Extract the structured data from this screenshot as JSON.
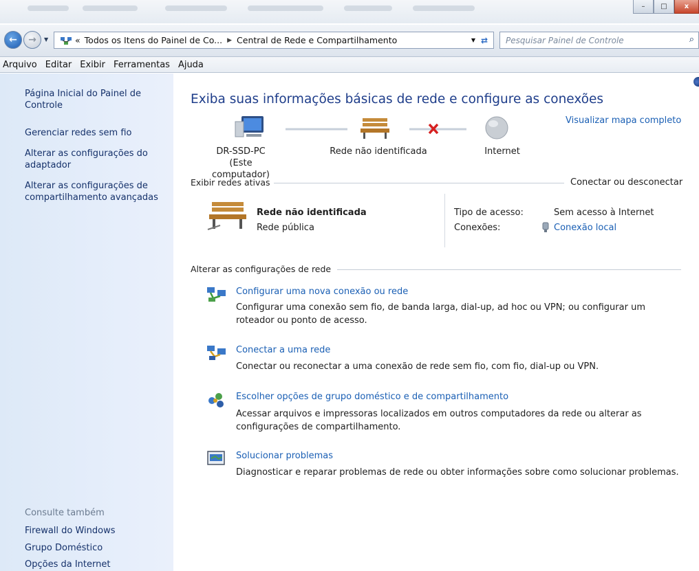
{
  "window": {
    "minimize": "–",
    "maximize": "□",
    "close": "x"
  },
  "address": {
    "crumb_prefix": "«",
    "crumb1": "Todos os Itens do Painel de Co...",
    "crumb2": "Central de Rede e Compartilhamento",
    "search_placeholder": "Pesquisar Painel de Controle"
  },
  "menu": [
    "Arquivo",
    "Editar",
    "Exibir",
    "Ferramentas",
    "Ajuda"
  ],
  "sidebar": {
    "links": [
      "Página Inicial do Painel de Controle",
      "Gerenciar redes sem fio",
      "Alterar as configurações do adaptador",
      "Alterar as configurações de compartilhamento avançadas"
    ],
    "see_also_label": "Consulte também",
    "see_also": [
      "Firewall do Windows",
      "Grupo Doméstico",
      "Opções da Internet"
    ]
  },
  "main": {
    "title": "Exiba suas informações básicas de rede e configure as conexões",
    "full_map_link": "Visualizar mapa completo",
    "nodes": {
      "computer": "DR-SSD-PC",
      "computer_sub": "(Este computador)",
      "network": "Rede não identificada",
      "internet": "Internet"
    },
    "active_header": "Exibir redes ativas",
    "connect_link": "Conectar ou desconectar",
    "active_network": {
      "name": "Rede não identificada",
      "type": "Rede pública",
      "access_label": "Tipo de acesso:",
      "access_value": "Sem acesso à Internet",
      "connections_label": "Conexões:",
      "connections_value": "Conexão local"
    },
    "change_header": "Alterar as configurações de rede",
    "tasks": [
      {
        "link": "Configurar uma nova conexão ou rede",
        "desc": "Configurar uma conexão sem fio, de banda larga, dial-up, ad hoc ou VPN; ou configurar um roteador ou ponto de acesso."
      },
      {
        "link": "Conectar a uma rede",
        "desc": "Conectar ou reconectar a uma conexão de rede sem fio, com fio, dial-up ou VPN."
      },
      {
        "link": "Escolher opções de grupo doméstico e de compartilhamento",
        "desc": "Acessar arquivos e impressoras localizados em outros computadores da rede ou alterar as configurações de compartilhamento."
      },
      {
        "link": "Solucionar problemas",
        "desc": "Diagnosticar e reparar problemas de rede ou obter informações sobre como solucionar problemas."
      }
    ]
  },
  "colors": {
    "link": "#1a5fb4",
    "title": "#1e3d8a",
    "sidebar_bg": "#dde9f7",
    "error_x": "#d62020"
  },
  "icons": {
    "computer": "computer-icon",
    "bench": "bench-icon",
    "globe": "globe-icon",
    "disconnected": "red-x-icon"
  }
}
